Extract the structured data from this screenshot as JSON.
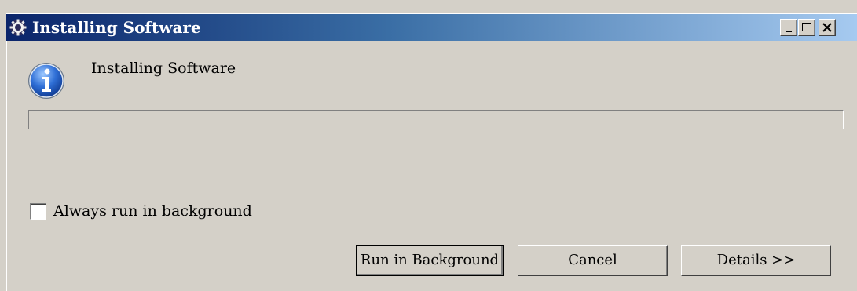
{
  "window": {
    "title": "Installing Software",
    "title_icon": "eclipse-gear-icon",
    "controls": {
      "minimize_icon": "minimize-icon",
      "maximize_icon": "maximize-icon",
      "close_icon": "close-icon"
    },
    "titlebar_colors": [
      "#0a246a",
      "#a6caf0"
    ]
  },
  "dialog": {
    "icon": "info-icon",
    "heading": "Installing Software",
    "progress": 0,
    "checkbox": {
      "label": "Always run in background",
      "checked": false
    },
    "buttons": {
      "run_in_background": "Run in Background",
      "cancel": "Cancel",
      "details": "Details >>"
    }
  }
}
